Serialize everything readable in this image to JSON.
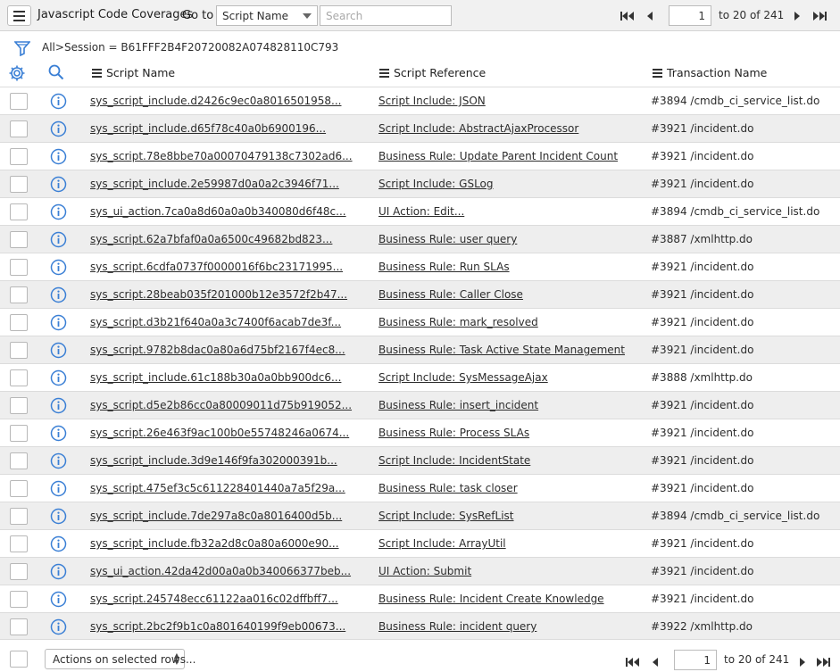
{
  "header": {
    "title": "Javascript Code Coverages",
    "goto_label": "Go to",
    "goto_field": "Script Name",
    "search_placeholder": "Search"
  },
  "pagination": {
    "page_value": "1",
    "range_text": "to 20 of 241"
  },
  "breadcrumb": {
    "all": "All",
    "separator": ">",
    "filter": "Session = B61FFF2B4F20720082A074828110C793"
  },
  "columns": {
    "script_name": "Script Name",
    "script_reference": "Script Reference",
    "transaction_name": "Transaction Name"
  },
  "rows": [
    {
      "script_name": "sys_script_include.d2426c9ec0a8016501958...",
      "script_reference": "Script Include: JSON",
      "transaction_name": "#3894 /cmdb_ci_service_list.do"
    },
    {
      "script_name": "sys_script_include.d65f78c40a0b6900196...",
      "script_reference": "Script Include: AbstractAjaxProcessor",
      "transaction_name": "#3921 /incident.do"
    },
    {
      "script_name": "sys_script.78e8bbe70a00070479138c7302ad6...",
      "script_reference": "Business Rule: Update Parent Incident Count",
      "transaction_name": "#3921 /incident.do"
    },
    {
      "script_name": "sys_script_include.2e59987d0a0a2c3946f71...",
      "script_reference": "Script Include: GSLog",
      "transaction_name": "#3921 /incident.do"
    },
    {
      "script_name": "sys_ui_action.7ca0a8d60a0a0b340080d6f48c...",
      "script_reference": "UI Action: Edit...",
      "transaction_name": "#3894 /cmdb_ci_service_list.do"
    },
    {
      "script_name": "sys_script.62a7bfaf0a0a6500c49682bd823...",
      "script_reference": "Business Rule: user query",
      "transaction_name": "#3887 /xmlhttp.do"
    },
    {
      "script_name": "sys_script.6cdfa0737f0000016f6bc23171995...",
      "script_reference": "Business Rule: Run SLAs",
      "transaction_name": "#3921 /incident.do"
    },
    {
      "script_name": "sys_script.28beab035f201000b12e3572f2b47...",
      "script_reference": "Business Rule: Caller Close",
      "transaction_name": "#3921 /incident.do"
    },
    {
      "script_name": "sys_script.d3b21f640a0a3c7400f6acab7de3f...",
      "script_reference": "Business Rule: mark_resolved",
      "transaction_name": "#3921 /incident.do"
    },
    {
      "script_name": "sys_script.9782b8dac0a80a6d75bf2167f4ec8...",
      "script_reference": "Business Rule: Task Active State Management",
      "transaction_name": "#3921 /incident.do"
    },
    {
      "script_name": "sys_script_include.61c188b30a0a0bb900dc6...",
      "script_reference": "Script Include: SysMessageAjax",
      "transaction_name": "#3888 /xmlhttp.do"
    },
    {
      "script_name": "sys_script.d5e2b86cc0a80009011d75b919052...",
      "script_reference": "Business Rule: insert_incident",
      "transaction_name": "#3921 /incident.do"
    },
    {
      "script_name": "sys_script.26e463f9ac100b0e55748246a0674...",
      "script_reference": "Business Rule: Process SLAs",
      "transaction_name": "#3921 /incident.do"
    },
    {
      "script_name": "sys_script_include.3d9e146f9fa302000391b...",
      "script_reference": "Script Include: IncidentState",
      "transaction_name": "#3921 /incident.do"
    },
    {
      "script_name": "sys_script.475ef3c5c611228401440a7a5f29a...",
      "script_reference": "Business Rule: task closer",
      "transaction_name": "#3921 /incident.do"
    },
    {
      "script_name": "sys_script_include.7de297a8c0a8016400d5b...",
      "script_reference": "Script Include: SysRefList",
      "transaction_name": "#3894 /cmdb_ci_service_list.do"
    },
    {
      "script_name": "sys_script_include.fb32a2d8c0a80a6000e90...",
      "script_reference": "Script Include: ArrayUtil",
      "transaction_name": "#3921 /incident.do"
    },
    {
      "script_name": "sys_ui_action.42da42d00a0a0b340066377beb...",
      "script_reference": "UI Action: Submit",
      "transaction_name": "#3921 /incident.do"
    },
    {
      "script_name": "sys_script.245748ecc61122aa016c02dffbff7...",
      "script_reference": "Business Rule: Incident Create Knowledge",
      "transaction_name": "#3921 /incident.do"
    },
    {
      "script_name": "sys_script.2bc2f9b1c0a801640199f9eb00673...",
      "script_reference": "Business Rule: incident query",
      "transaction_name": "#3922 /xmlhttp.do"
    }
  ],
  "footer": {
    "actions_label": "Actions on selected rows..."
  },
  "icons": {
    "pager_first": "first-page-icon",
    "pager_prev": "prev-page-icon",
    "pager_next": "next-page-icon",
    "pager_last": "last-page-icon",
    "row_info": "info-circle-icon"
  },
  "colors": {
    "link_blue": "#2a5fb0",
    "info_blue": "#3a7fd5",
    "row_alt": "#eeeeee"
  }
}
